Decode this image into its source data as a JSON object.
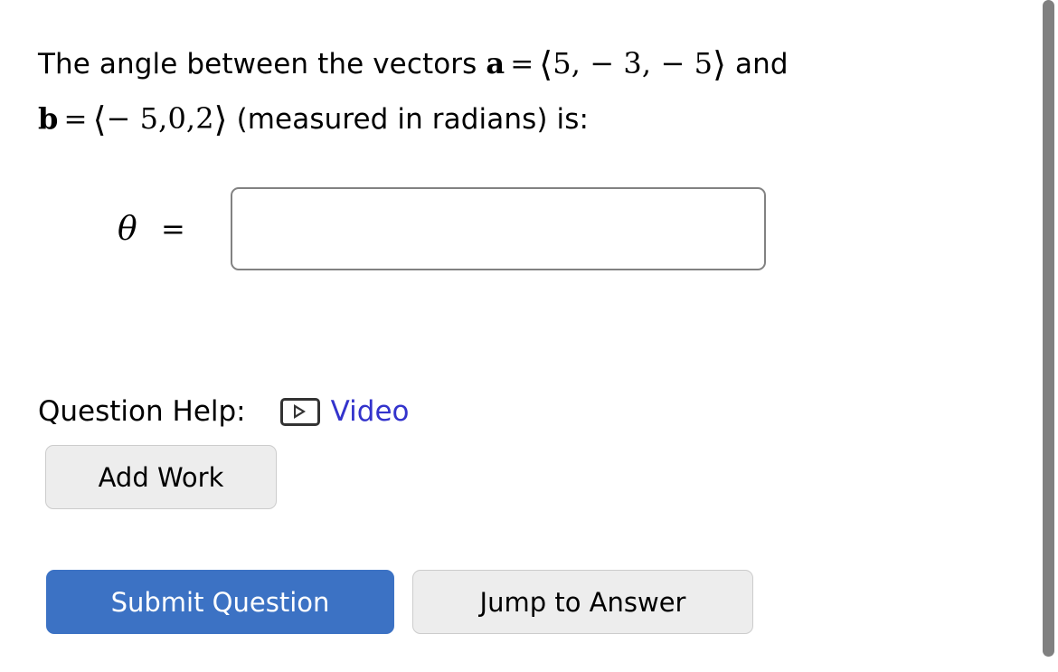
{
  "question": {
    "intro": "The angle between the vectors",
    "vector_a": {
      "name": "a",
      "equals": "=",
      "open": "⟨",
      "components": [
        "5",
        "− 3",
        "− 5"
      ],
      "close": "⟩"
    },
    "conjunction": "and",
    "vector_b": {
      "name": "b",
      "equals": "=",
      "open": "⟨",
      "components": [
        "− 5",
        "0",
        "2"
      ],
      "close": "⟩"
    },
    "tail": "(measured in radians) is:"
  },
  "answer": {
    "symbol": "θ",
    "equals": "=",
    "input_value": "",
    "input_placeholder": ""
  },
  "help": {
    "label": "Question Help:",
    "icon": "video-play-icon",
    "link_label": "Video",
    "link_color": "#3333cc"
  },
  "buttons": {
    "add_work": "Add Work",
    "submit": "Submit Question",
    "jump": "Jump to Answer",
    "primary_color": "#3c72c4",
    "secondary_color": "#ededed"
  },
  "scrollbar": {
    "thumb_color": "#808080"
  }
}
